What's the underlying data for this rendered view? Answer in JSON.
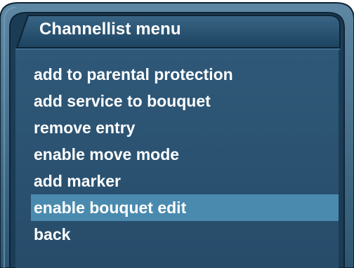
{
  "window": {
    "title": "Channellist menu"
  },
  "menu": {
    "items": [
      {
        "label": "add to parental protection",
        "selected": false
      },
      {
        "label": "add service to bouquet",
        "selected": false
      },
      {
        "label": "remove entry",
        "selected": false
      },
      {
        "label": "enable move mode",
        "selected": false
      },
      {
        "label": "add marker",
        "selected": false
      },
      {
        "label": "enable bouquet edit",
        "selected": true
      },
      {
        "label": "back",
        "selected": false
      }
    ]
  },
  "colors": {
    "panel_background": "#2a5070",
    "title_bar": "#1f4460",
    "frame_border": "#0f2537",
    "selection_highlight": "#4a8aae",
    "text": "#ffffff"
  }
}
